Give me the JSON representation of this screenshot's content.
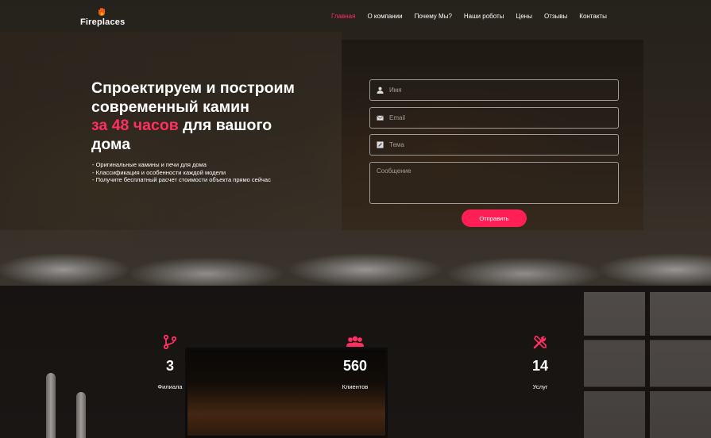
{
  "brand": {
    "name": "Fireplaces"
  },
  "nav": {
    "items": [
      {
        "label": "Главная",
        "active": true
      },
      {
        "label": "О компании"
      },
      {
        "label": "Почему Мы?"
      },
      {
        "label": "Наши роботы"
      },
      {
        "label": "Цены"
      },
      {
        "label": "Отзывы"
      },
      {
        "label": "Контакты"
      }
    ]
  },
  "hero": {
    "title_line1": "Спроектируем и построим",
    "title_line2": "современный камин",
    "title_accent": "за 48 часов",
    "title_line3_rest": " для вашого",
    "title_line4": "дома",
    "bullets": [
      "- Оригинальные камины и печи для дома",
      "- Классификация и особенности каждой модели",
      "- Получите бесплатный расчет стоимости объекта прямо сейчас"
    ]
  },
  "form": {
    "name_placeholder": "Имя",
    "email_placeholder": "Email",
    "subject_placeholder": "Тема",
    "message_placeholder": "Сообщение",
    "submit_label": "Отправить"
  },
  "stats": [
    {
      "value": "3",
      "label": "Филиала",
      "icon": "branch-icon"
    },
    {
      "value": "560",
      "label": "Клиентов",
      "icon": "clients-icon"
    },
    {
      "value": "14",
      "label": "Услуг",
      "icon": "tools-icon"
    }
  ],
  "colors": {
    "accent": "#ff2f61",
    "button": "#ff1f55",
    "icon": "#ff2f61"
  }
}
